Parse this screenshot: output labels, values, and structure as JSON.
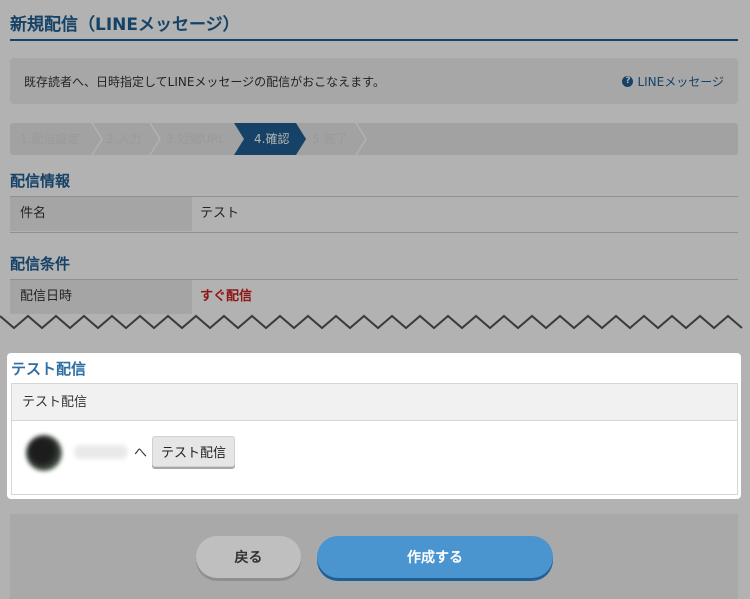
{
  "header": {
    "title": "新規配信（LINEメッセージ）"
  },
  "info": {
    "description": "既存読者へ、日時指定してLINEメッセージの配信がおこなえます。",
    "help_link": "LINEメッセージ",
    "help_icon": "question-circle-icon"
  },
  "steps": [
    {
      "label": "1.配信設定",
      "active": false
    },
    {
      "label": "2.入力",
      "active": false
    },
    {
      "label": "3.短縮URL",
      "active": false
    },
    {
      "label": "4.確認",
      "active": true
    },
    {
      "label": "5.完了",
      "active": false
    }
  ],
  "sections": {
    "delivery_info": {
      "heading": "配信情報",
      "row_label": "件名",
      "row_value": "テスト"
    },
    "delivery_conditions": {
      "heading": "配信条件",
      "row_label": "配信日時",
      "row_value": "すぐ配信"
    }
  },
  "test_modal": {
    "title": "テスト配信",
    "table_header": "テスト配信",
    "recipient_suffix": "へ",
    "button_label": "テスト配信"
  },
  "footer": {
    "back_label": "戻る",
    "create_label": "作成する"
  },
  "colors": {
    "accent": "#1f5f93",
    "danger": "#cc2222"
  }
}
